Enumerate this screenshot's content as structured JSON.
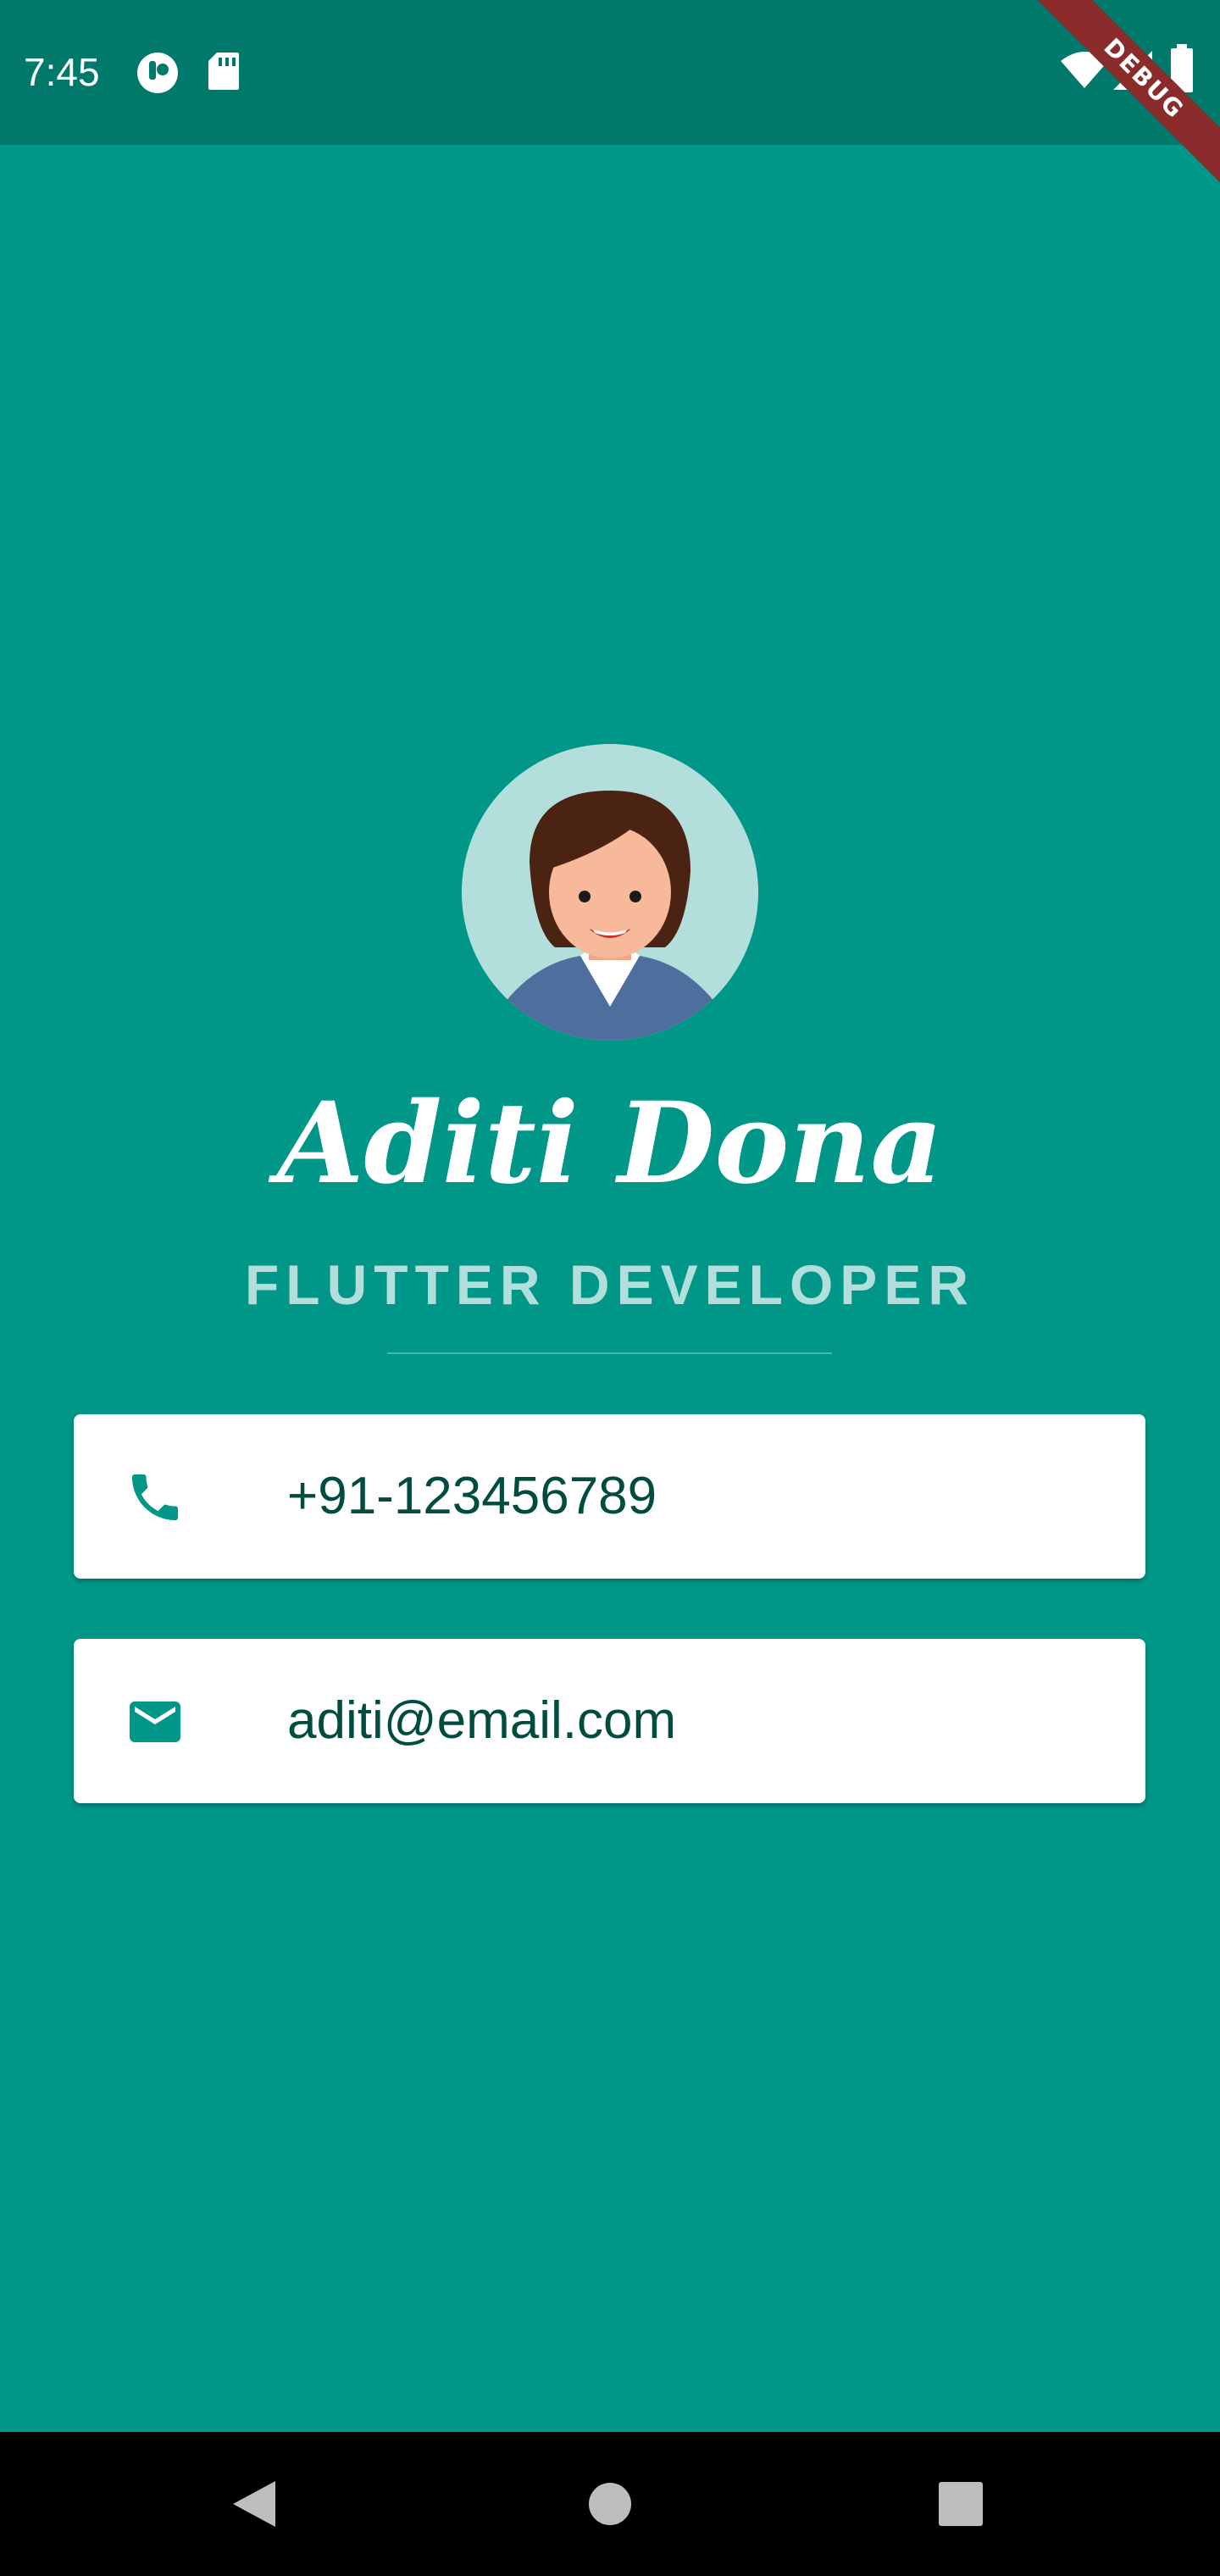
{
  "status_bar": {
    "time": "7:45",
    "icons_left": [
      "assistant-icon",
      "sd-card-icon"
    ],
    "icons_right": [
      "wifi-icon",
      "signal-icon",
      "battery-icon"
    ],
    "debug_label": "DEBUG"
  },
  "profile": {
    "name": "Aditi Dona",
    "title": "FLUTTER DEVELOPER"
  },
  "contacts": {
    "phone": {
      "icon": "phone-icon",
      "value": "+91-123456789"
    },
    "email": {
      "icon": "mail-icon",
      "value": "aditi@email.com"
    }
  },
  "nav": {
    "items": [
      "back-icon",
      "home-icon",
      "recents-icon"
    ]
  },
  "colors": {
    "background": "#009688",
    "status_bar": "#00796B",
    "card_text": "#004D40",
    "title": "#B2DFDB"
  }
}
